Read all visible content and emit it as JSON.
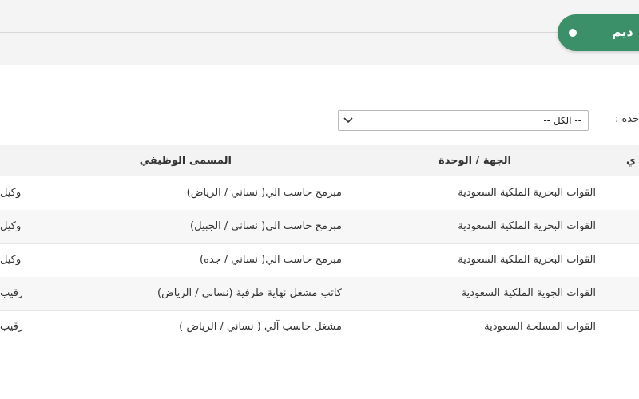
{
  "header": {
    "apply_label": "ديم"
  },
  "filter": {
    "label": "حدة :",
    "selected": "-- الكل --"
  },
  "table": {
    "columns": {
      "entity": "الجهة / الوحدة",
      "job_title": "المسمى الوظيفي",
      "rank_partial": "ي"
    },
    "rows": [
      {
        "entity": "القوات البحرية الملكية السعودية",
        "job_title": "مبرمج حاسب الي( نساني / الرياض)",
        "rank_partial": "وكيل"
      },
      {
        "entity": "القوات البحرية الملكية السعودية",
        "job_title": "مبرمج حاسب الي( نساني / الجبيل)",
        "rank_partial": "وكيل"
      },
      {
        "entity": "القوات البحرية الملكية السعودية",
        "job_title": "مبرمج حاسب الي( نساني / جده)",
        "rank_partial": "وكيل"
      },
      {
        "entity": "القوات الجوية الملكية السعودية",
        "job_title": "كاتب مشغل نهاية طرفية (نساني / الرياض)",
        "rank_partial": "رقيب"
      },
      {
        "entity": "القوات المسلحة السعودية",
        "job_title": "مشغل حاسب آلي ( نساني / الرياض )",
        "rank_partial": "رقيب"
      }
    ]
  }
}
